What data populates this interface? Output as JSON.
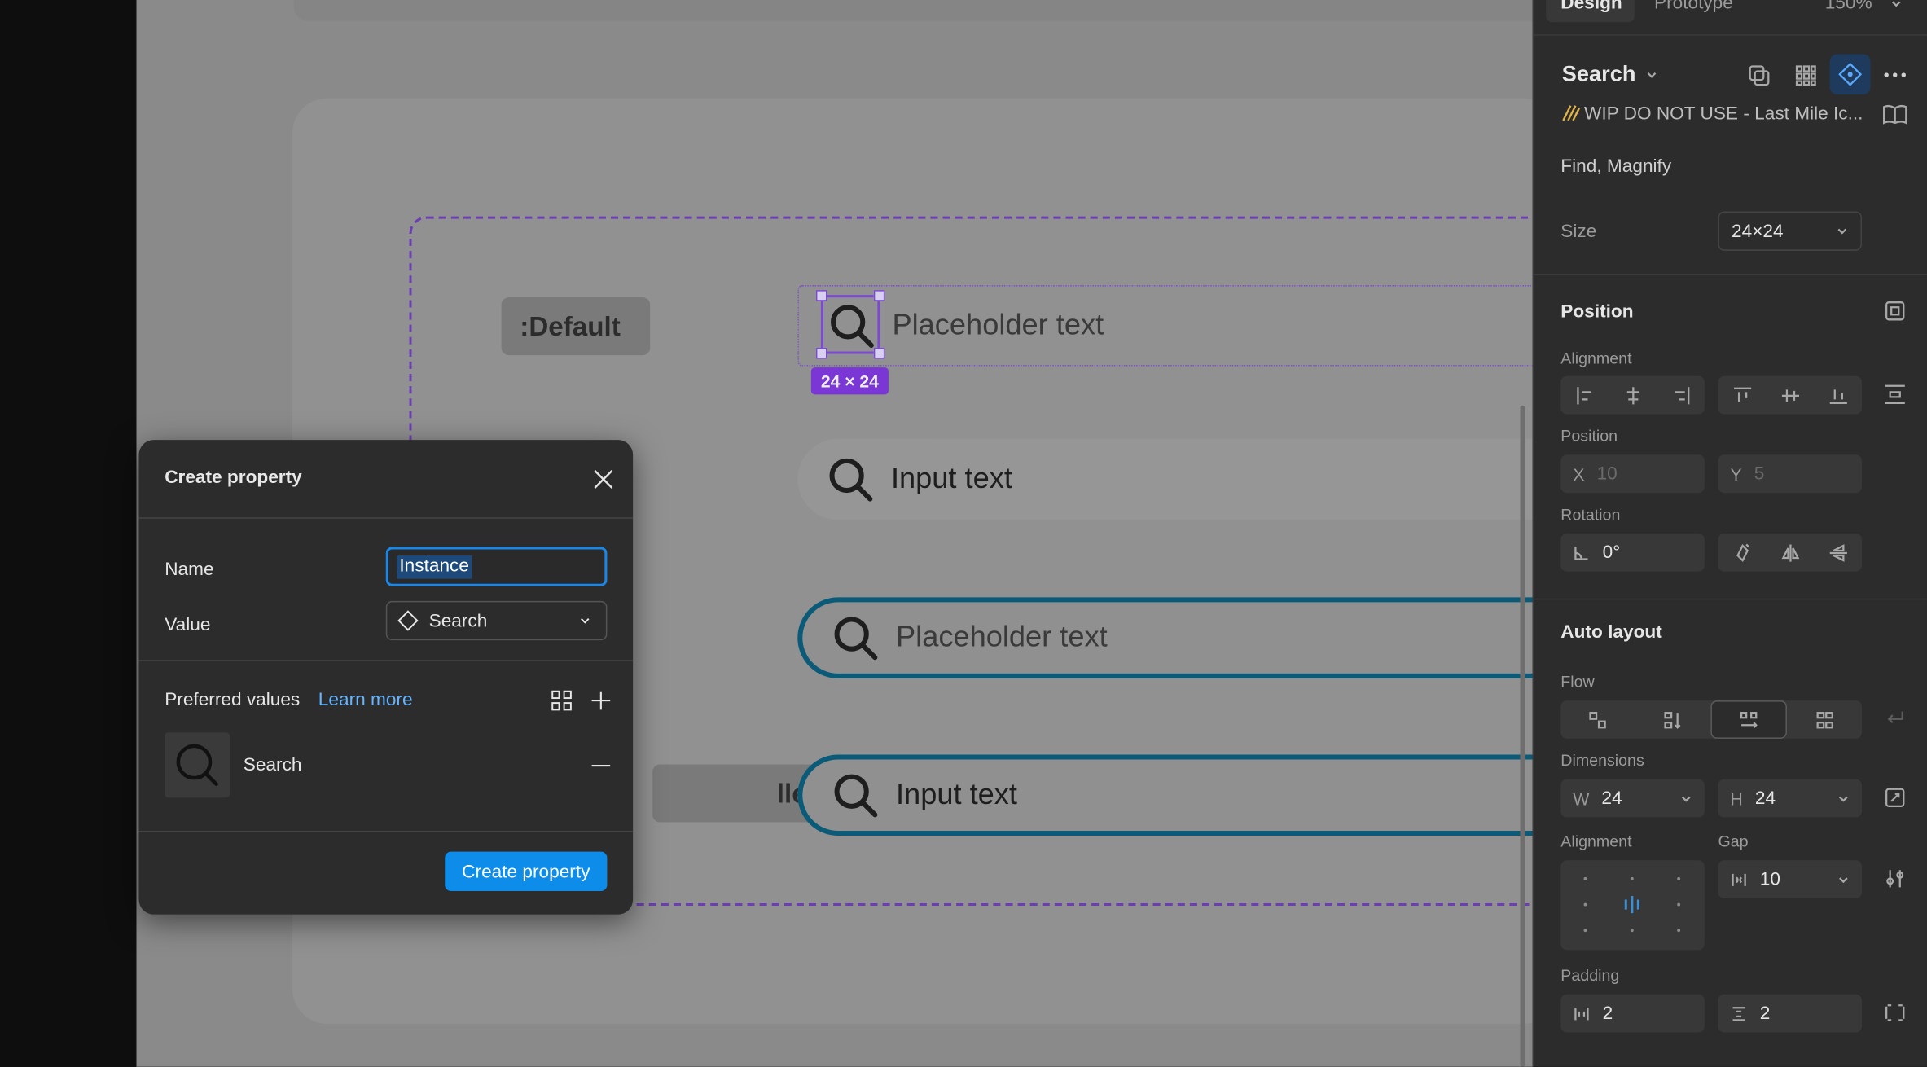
{
  "canvas": {
    "states": {
      "default": ":Default",
      "filled": "lled"
    },
    "fields": {
      "placeholder": "Placeholder text",
      "input": "Input text"
    },
    "size_badge": "24 × 24",
    "clear_glyph": "✕"
  },
  "dialog": {
    "title": "Create property",
    "name_label": "Name",
    "name_value": "Instance",
    "value_label": "Value",
    "value_selected": "Search",
    "preferred_label": "Preferred values",
    "learn_more": "Learn more",
    "preferred_items": [
      {
        "label": "Search"
      }
    ],
    "create_button": "Create property"
  },
  "panel": {
    "tabs": {
      "design": "Design",
      "prototype": "Prototype",
      "zoom": "150%"
    },
    "component_name": "Search",
    "library": "WIP DO NOT USE - Last Mile Ic...",
    "description": "Find, Magnify",
    "size_label": "Size",
    "size_value": "24×24",
    "position": {
      "title": "Position",
      "alignment_label": "Alignment",
      "position_label": "Position",
      "x_label": "X",
      "x_value": "10",
      "y_label": "Y",
      "y_value": "5",
      "rotation_label": "Rotation",
      "rotation_value": "0°"
    },
    "auto_layout": {
      "title": "Auto layout",
      "flow_label": "Flow",
      "dimensions_label": "Dimensions",
      "w_label": "W",
      "w_value": "24",
      "h_label": "H",
      "h_value": "24",
      "alignment_label": "Alignment",
      "gap_label": "Gap",
      "gap_value": "10",
      "padding_label": "Padding",
      "padding_h": "2",
      "padding_v": "2"
    }
  },
  "colors": {
    "accent": "#0d8ce9",
    "selection": "#7a37d6",
    "focus_border": "#0b5a78"
  }
}
